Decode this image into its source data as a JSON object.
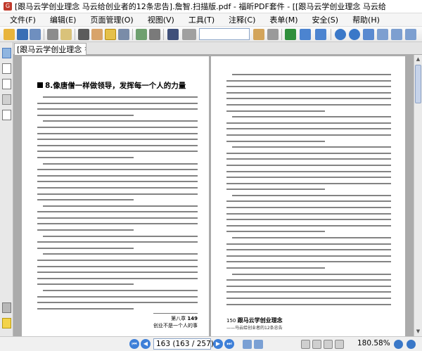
{
  "window": {
    "title": "[跟马云学创业理念  马云给创业者的12条忠告].詹智.扫描版.pdf - 福昕PDF套件 - [[跟马云学创业理念  马云给"
  },
  "menu": {
    "items": [
      "文件(F)",
      "编辑(E)",
      "页面管理(O)",
      "视图(V)",
      "工具(T)",
      "注释(C)",
      "表单(M)",
      "安全(S)",
      "帮助(H)"
    ]
  },
  "toolbar": {
    "search_value": "",
    "icons": [
      "open-folder-icon",
      "save-icon",
      "save-as-icon",
      "print-icon",
      "email-icon",
      "select-text-icon",
      "hand-tool-icon",
      "snapshot-icon",
      "zoom-tool-icon",
      "image-icon",
      "find-icon",
      "search-icon",
      "first-page-icon",
      "previous-view-icon",
      "next-view-icon",
      "zoom-in-icon",
      "zoom-out-icon",
      "zoom-dropdown-icon",
      "fit-page-icon",
      "fit-width-icon"
    ]
  },
  "tab": {
    "label": "[跟马云学创业理念",
    "close": "×"
  },
  "page_left": {
    "heading": "8.像唐僧一样做领导，发挥每一个人的力量",
    "footer_title": "创业不是一个人的事",
    "footer_section": "第八章",
    "page_number": "149"
  },
  "page_right": {
    "page_number": "150",
    "book_title": "跟马云学创业理念",
    "book_subtitle": "——马云给创业者的12条忠告"
  },
  "status": {
    "page_display": "163 (163 / 257)",
    "zoom": "180.58%",
    "current_page": 163,
    "total_pages": 257
  }
}
